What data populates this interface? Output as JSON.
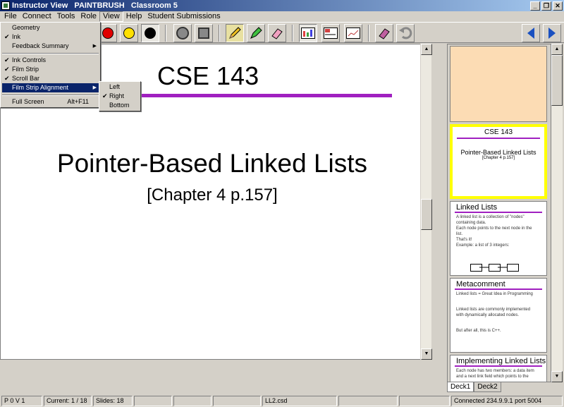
{
  "window": {
    "title": "Instructor View   PAINTBRUSH   Classroom 5",
    "buttons": {
      "minimize": "_",
      "restore": "❐",
      "close": "✕"
    }
  },
  "menubar": {
    "items": [
      "File",
      "Connect",
      "Tools",
      "Role",
      "View",
      "Help",
      "Student Submissions"
    ]
  },
  "view_menu": {
    "items": [
      {
        "label": "Geometry",
        "checked": false,
        "submenu": false
      },
      {
        "label": "Ink",
        "checked": true,
        "submenu": false
      },
      {
        "label": "Feedback Summary",
        "checked": false,
        "submenu": true
      },
      {
        "label": "Ink Controls",
        "checked": true,
        "submenu": false
      },
      {
        "label": "Film Strip",
        "checked": true,
        "submenu": false
      },
      {
        "label": "Scroll Bar",
        "checked": true,
        "submenu": false
      },
      {
        "label": "Film Strip Alignment",
        "checked": false,
        "submenu": true
      },
      {
        "label": "Full Screen",
        "shortcut": "Alt+F11"
      }
    ],
    "alignment_submenu": [
      {
        "label": "Left",
        "checked": false
      },
      {
        "label": "Right",
        "checked": true
      },
      {
        "label": "Bottom",
        "checked": false
      }
    ]
  },
  "toolbar": {
    "colors": {
      "red": "#e00000",
      "yellow": "#ffe000",
      "black": "#000000"
    },
    "icons": [
      "red-pen-icon",
      "yellow-pen-icon",
      "black-pen-icon",
      "circle-pen-icon",
      "square-pen-icon",
      "pencil-icon",
      "highlighter-icon",
      "eraser-icon",
      "layout-1-icon",
      "layout-2-icon",
      "layout-3-icon",
      "erase-all-icon",
      "undo-icon",
      "prev-slide-icon",
      "next-slide-icon"
    ]
  },
  "slide": {
    "title": "CSE 143",
    "heading": "Pointer-Based Linked Lists",
    "subheading": "[Chapter 4 p.157]",
    "accent_color": "#a020c0"
  },
  "filmstrip": {
    "thumbs": [
      {
        "type": "blank"
      },
      {
        "type": "current",
        "title": "CSE 143",
        "heading": "Pointer-Based Linked Lists",
        "sub": "[Chapter 4 p.157]"
      },
      {
        "type": "content",
        "title": "Linked Lists",
        "lines": [
          "A linked list is a collection of \"nodes\"",
          "containing data.",
          "Each node points to the next node in the",
          "list.",
          "That's it!",
          "Example: a list of 3 integers:"
        ]
      },
      {
        "type": "content",
        "title": "Metacomment",
        "lines": [
          "Linked lists = Great Idea in Programming",
          "",
          "Linked lists are commonly implemented",
          "with dynamically allocated nodes.",
          "",
          "But after all, this is C++."
        ]
      },
      {
        "type": "content",
        "title": "Implementing Linked Lists",
        "lines": [
          "Each node has two members: a data item",
          "and a next link field which points to the"
        ]
      }
    ],
    "tabs": [
      "Deck1",
      "Deck2"
    ]
  },
  "statusbar": {
    "panels": [
      "P 0 V 1",
      "Current: 1 / 18",
      "Slides: 18",
      "",
      "",
      "",
      "LL2.csd",
      "",
      "",
      "Connected 234.9.9.1 port 5004"
    ]
  }
}
